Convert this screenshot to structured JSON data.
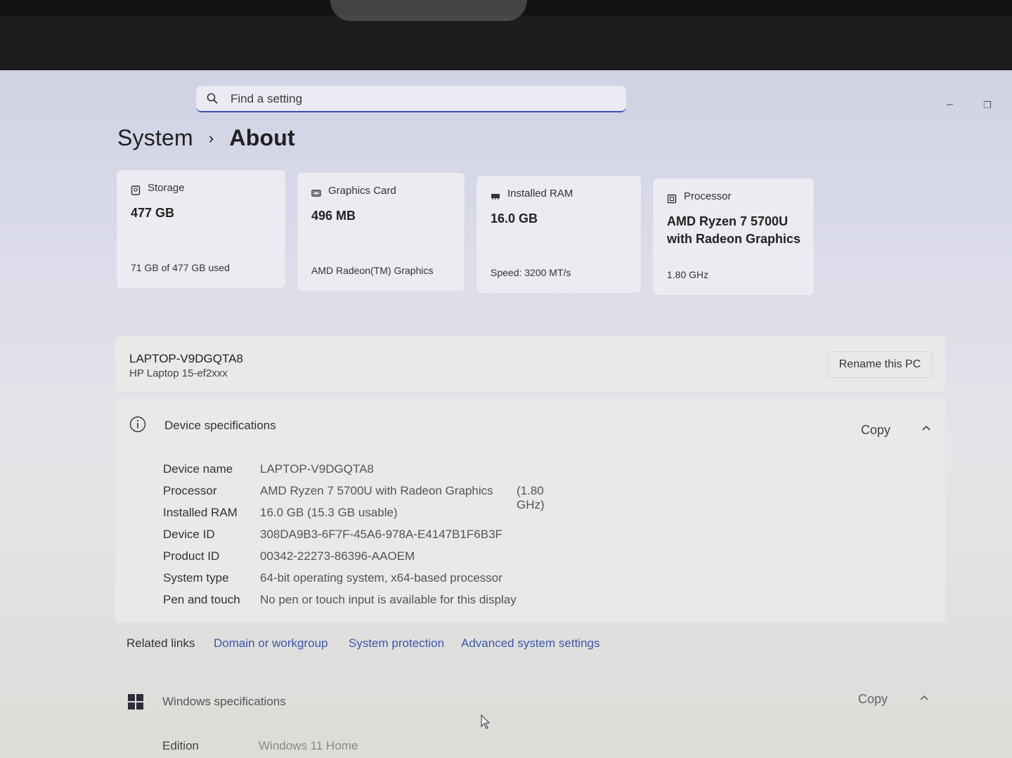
{
  "search": {
    "placeholder": "Find a setting"
  },
  "breadcrumb": {
    "parent": "System",
    "separator": "›",
    "current": "About"
  },
  "cards": [
    {
      "icon": "storage-icon",
      "title": "Storage",
      "value": "477 GB",
      "sub": "71 GB of 477 GB used"
    },
    {
      "icon": "graphics-card-icon",
      "title": "Graphics Card",
      "value": "496 MB",
      "sub": "AMD Radeon(TM) Graphics"
    },
    {
      "icon": "ram-icon",
      "title": "Installed RAM",
      "value": "16.0 GB",
      "sub": "Speed: 3200 MT/s"
    },
    {
      "icon": "processor-icon",
      "title": "Processor",
      "value_line1": "AMD Ryzen 7 5700U",
      "value_line2": "with Radeon Graphics",
      "sub": "1.80 GHz"
    }
  ],
  "pc": {
    "name": "LAPTOP-V9DGQTA8",
    "model": "HP Laptop 15-ef2xxx",
    "rename_label": "Rename this PC"
  },
  "device_specs": {
    "title": "Device specifications",
    "copy_label": "Copy",
    "rows": [
      {
        "key": "Device name",
        "value": "LAPTOP-V9DGQTA8"
      },
      {
        "key": "Processor",
        "value": "AMD Ryzen 7 5700U with Radeon Graphics",
        "extra": "(1.80 GHz)"
      },
      {
        "key": "Installed RAM",
        "value": "16.0 GB (15.3 GB usable)"
      },
      {
        "key": "Device ID",
        "value": "308DA9B3-6F7F-45A6-978A-E4147B1F6B3F"
      },
      {
        "key": "Product ID",
        "value": "00342-22273-86396-AAOEM"
      },
      {
        "key": "System type",
        "value": "64-bit operating system, x64-based processor"
      },
      {
        "key": "Pen and touch",
        "value": "No pen or touch input is available for this display"
      }
    ]
  },
  "related_links": {
    "label": "Related links",
    "links": [
      "Domain or workgroup",
      "System protection",
      "Advanced system settings"
    ]
  },
  "windows_specs": {
    "title": "Windows specifications",
    "copy_label": "Copy",
    "rows": [
      {
        "key": "Edition",
        "value": "Windows 11 Home"
      }
    ]
  },
  "window_controls": {
    "minimize": "–",
    "restore": "❐"
  },
  "colors": {
    "accent": "#3a4fb0",
    "link": "#3a57a8"
  }
}
